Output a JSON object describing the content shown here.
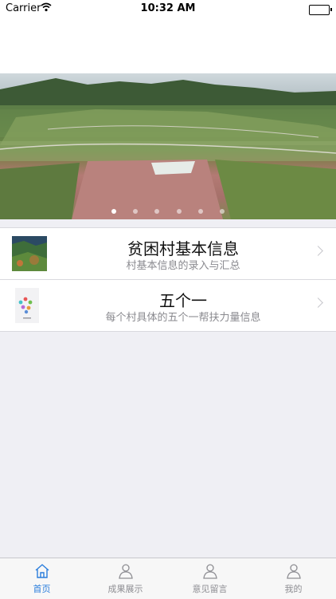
{
  "status_bar": {
    "carrier": "Carrier",
    "time": "10:32 AM"
  },
  "banner": {
    "slides_count": 6,
    "active_slide": 1
  },
  "list": [
    {
      "title": "贫困村基本信息",
      "subtitle": "村基本信息的录入与汇总",
      "icon": "village-photo-thumbnail"
    },
    {
      "title": "五个一",
      "subtitle": "每个村具体的五个一帮扶力量信息",
      "icon": "colorful-dots-thumbnail"
    }
  ],
  "tabs": [
    {
      "label": "首页",
      "icon": "home-icon",
      "active": true
    },
    {
      "label": "成果展示",
      "icon": "person-icon",
      "active": false
    },
    {
      "label": "意见留言",
      "icon": "person-icon",
      "active": false
    },
    {
      "label": "我的",
      "icon": "person-icon",
      "active": false
    }
  ],
  "colors": {
    "accent": "#2a7ddc",
    "inactive": "#8e8e93",
    "background": "#efeff4"
  }
}
